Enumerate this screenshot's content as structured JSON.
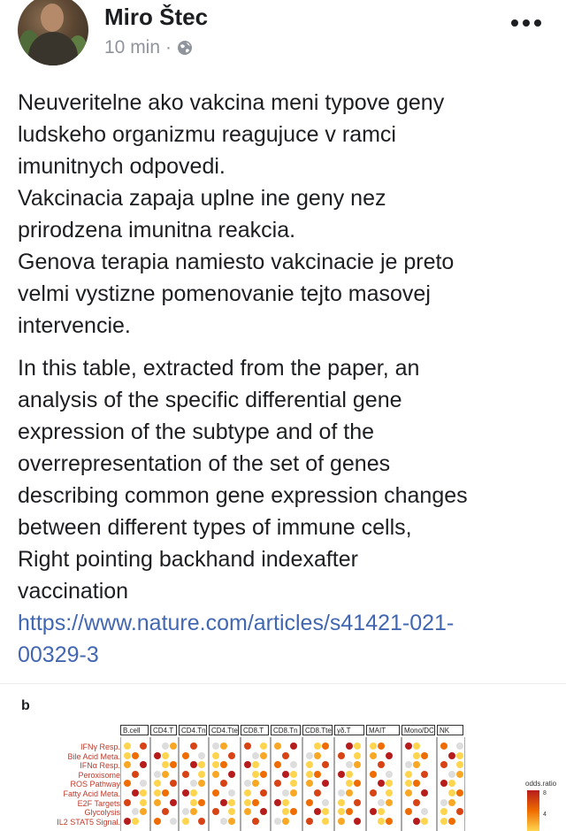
{
  "post": {
    "author": "Miro Štec",
    "time": "10 min",
    "separator": "·",
    "privacy_icon": "globe-icon",
    "menu_icon": "more-options-icon",
    "paragraph1": [
      "Neuveritelne ako vakcina meni typove geny",
      "ludskeho organizmu reagujuce v ramci",
      "imunitnych odpovedi.",
      "Vakcinacia zapaja uplne ine geny nez",
      "prirodzena imunitna reakcia.",
      "Genova terapia namiesto vakcinacie je preto",
      "velmi vystizne pomenovanie tejto masovej",
      "intervencie."
    ],
    "paragraph2": [
      "In this table, extracted from the paper, an",
      "analysis of the specific differential gene",
      "expression of the subtype and of the",
      "overrepresentation of the set of genes",
      "describing common gene expression changes",
      "between different types of immune cells,",
      "Right pointing backhand indexafter",
      "vaccination"
    ],
    "link_lines": [
      "https://www.nature.com/articles/s41421-021-",
      "00329-3"
    ]
  },
  "figure": {
    "panel_label": "b",
    "row_labels": [
      "IFNγ Resp.",
      "Bile Acid Meta.",
      "IFNα Resp.",
      "Peroxisome",
      "ROS Pathway",
      "Fatty Acid Meta.",
      "E2F Targets",
      "Glycolysis",
      "IL2 STAT5 Signal."
    ],
    "columns": [
      "B.cell",
      "CD4.T",
      "CD4.Tn",
      "CD4.Tte",
      "CD8.T",
      "CD8.Tn",
      "CD8.Tte",
      "γδ.T",
      "MAIT",
      "Mono/DC",
      "NK"
    ],
    "legend_title": "odds.ratio",
    "legend_ticks": [
      "8",
      "4"
    ],
    "colors": {
      "high": "#b71c1c",
      "mid": "#ef6c00",
      "low": "#ffd54f",
      "none": "#dddddd",
      "link": "#4267b2"
    }
  }
}
